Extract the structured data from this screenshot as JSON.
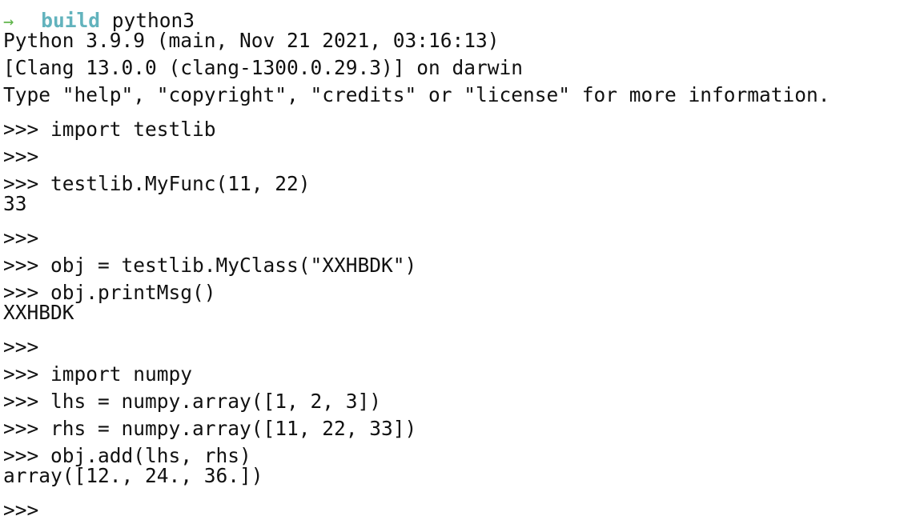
{
  "terminal": {
    "background_color": "#ffffff",
    "foreground_color": "#111111",
    "prompt_bracket_color": "#9a9a9a",
    "arrow_color": "#5fb54a",
    "command_color": "#62b3bd",
    "prompt_bracket": "[",
    "arrow_icon": "→",
    "repl_prompt": ">>>",
    "shell_command_name": "build",
    "shell_command_args": "python3",
    "lines": [
      {
        "kind": "shell-prompt",
        "bracket": "[",
        "arrow": "→",
        "command": "build",
        "args": "python3"
      },
      {
        "kind": "output",
        "text": "Python 3.9.9 (main, Nov 21 2021, 03:16:13)"
      },
      {
        "kind": "output",
        "text": "[Clang 13.0.0 (clang-1300.0.29.3)] on darwin"
      },
      {
        "kind": "output",
        "text": "Type \"help\", \"copyright\", \"credits\" or \"license\" for more information."
      },
      {
        "kind": "repl",
        "prompt": ">>>",
        "text": "import testlib"
      },
      {
        "kind": "repl",
        "prompt": ">>>",
        "text": ""
      },
      {
        "kind": "repl",
        "prompt": ">>>",
        "text": "testlib.MyFunc(11, 22)"
      },
      {
        "kind": "output",
        "text": "33"
      },
      {
        "kind": "repl",
        "prompt": ">>>",
        "text": ""
      },
      {
        "kind": "repl",
        "prompt": ">>>",
        "text": "obj = testlib.MyClass(\"XXHBDK\")"
      },
      {
        "kind": "repl",
        "prompt": ">>>",
        "text": "obj.printMsg()"
      },
      {
        "kind": "output",
        "text": "XXHBDK"
      },
      {
        "kind": "repl",
        "prompt": ">>>",
        "text": ""
      },
      {
        "kind": "repl",
        "prompt": ">>>",
        "text": "import numpy"
      },
      {
        "kind": "repl",
        "prompt": ">>>",
        "text": "lhs = numpy.array([1, 2, 3])"
      },
      {
        "kind": "repl",
        "prompt": ">>>",
        "text": "rhs = numpy.array([11, 22, 33])"
      },
      {
        "kind": "repl",
        "prompt": ">>>",
        "text": "obj.add(lhs, rhs)"
      },
      {
        "kind": "output",
        "text": "array([12., 24., 36.])"
      },
      {
        "kind": "repl",
        "prompt": ">>>",
        "text": ""
      }
    ]
  }
}
